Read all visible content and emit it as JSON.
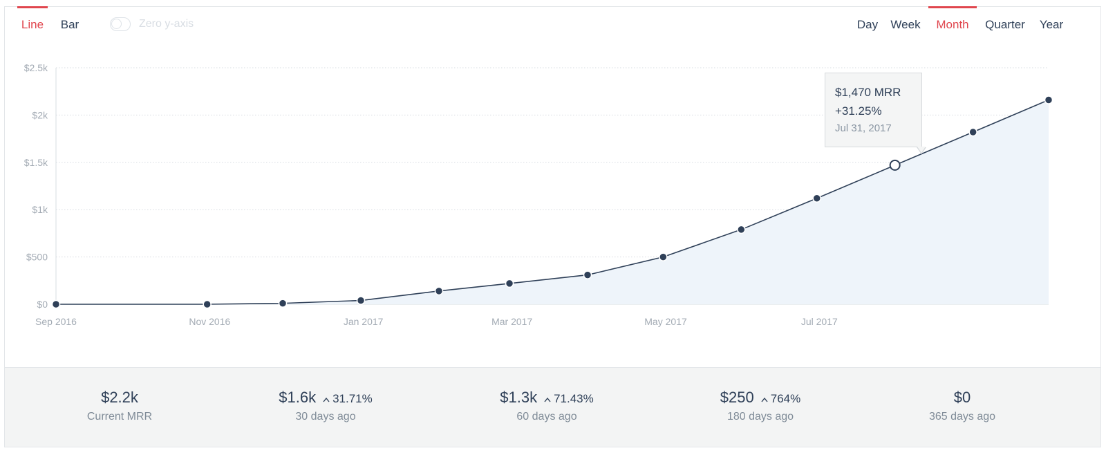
{
  "chart_controls": {
    "type_tabs": [
      {
        "label": "Line",
        "active": true
      },
      {
        "label": "Bar",
        "active": false
      }
    ],
    "zero_axis": {
      "label": "Zero y-axis",
      "enabled": false
    },
    "period_tabs": [
      {
        "label": "Day",
        "active": false
      },
      {
        "label": "Week",
        "active": false
      },
      {
        "label": "Month",
        "active": true
      },
      {
        "label": "Quarter",
        "active": false
      },
      {
        "label": "Year",
        "active": false
      }
    ]
  },
  "colors": {
    "accent": "#e0464e",
    "line": "#2f4058",
    "area": "#eef4fa",
    "grid": "#d7dce1",
    "tick_text": "#a3abb4"
  },
  "tooltip": {
    "value": "$1,470 MRR",
    "change": "+31.25%",
    "date": "Jul 31, 2017",
    "point_index": 10
  },
  "chart_data": {
    "type": "area",
    "x": [
      "2016-09-30",
      "2016-10-31",
      "2016-11-30",
      "2016-12-31",
      "2017-01-31",
      "2017-02-28",
      "2017-03-31",
      "2017-04-30",
      "2017-05-31",
      "2017-06-30",
      "2017-07-31",
      "2017-08-31",
      "2017-09-30"
    ],
    "series": [
      {
        "name": "",
        "values": [
          0,
          0,
          10,
          40,
          140,
          220,
          310,
          500,
          790,
          1120,
          1470,
          1820,
          2160
        ]
      }
    ],
    "ylim": [
      0,
      2500
    ],
    "y_ticks": [
      {
        "value": 0,
        "label": "$0"
      },
      {
        "value": 500,
        "label": "$500"
      },
      {
        "value": 1000,
        "label": "$1k"
      },
      {
        "value": 1500,
        "label": "$1.5k"
      },
      {
        "value": 2000,
        "label": "$2k"
      },
      {
        "value": 2500,
        "label": "$2.5k"
      }
    ],
    "x_ticks": [
      {
        "date": "2016-09-01",
        "label": "Sep 2016"
      },
      {
        "date": "2016-11-01",
        "label": "Nov 2016"
      },
      {
        "date": "2017-01-01",
        "label": "Jan 2017"
      },
      {
        "date": "2017-03-01",
        "label": "Mar 2017"
      },
      {
        "date": "2017-05-01",
        "label": "May 2017"
      },
      {
        "date": "2017-07-01",
        "label": "Jul 2017"
      }
    ],
    "title": "",
    "xlabel": "",
    "ylabel": "",
    "grid": true
  },
  "stats": [
    {
      "value": "$2.2k",
      "change": "",
      "label": "Current MRR"
    },
    {
      "value": "$1.6k",
      "change": "31.71%",
      "label": "30 days ago"
    },
    {
      "value": "$1.3k",
      "change": "71.43%",
      "label": "60 days ago"
    },
    {
      "value": "$250",
      "change": "764%",
      "label": "180 days ago"
    },
    {
      "value": "$0",
      "change": "",
      "label": "365 days ago"
    }
  ]
}
